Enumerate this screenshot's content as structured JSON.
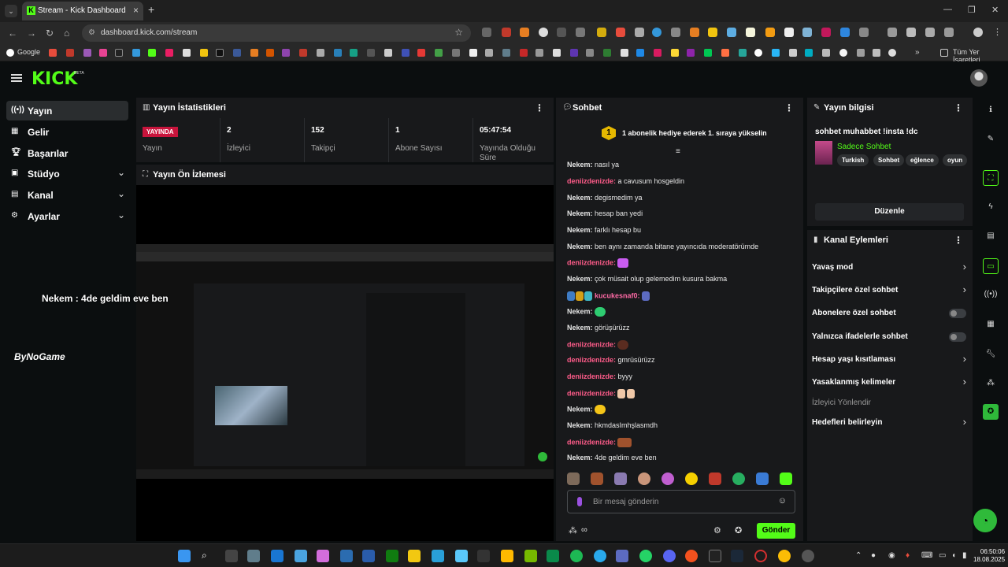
{
  "browser": {
    "tab_title": "Stream - Kick Dashboard",
    "url": "dashboard.kick.com/stream",
    "bookmark_google": "Google",
    "bookmark_all": "Tüm Yer İşaretleri"
  },
  "app": {
    "logo": "KICK",
    "logo_badge": "BETA"
  },
  "sidebar": {
    "items": [
      {
        "label": "Yayın",
        "icon": "broadcast-icon"
      },
      {
        "label": "Gelir",
        "icon": "income-icon"
      },
      {
        "label": "Başarılar",
        "icon": "trophy-icon"
      },
      {
        "label": "Stüdyo",
        "icon": "studio-icon"
      },
      {
        "label": "Kanal",
        "icon": "channel-icon"
      },
      {
        "label": "Ayarlar",
        "icon": "settings-icon"
      }
    ]
  },
  "stats": {
    "title": "Yayın İstatistikleri",
    "live_badge": "YAYINDA",
    "live_label": "Yayın",
    "viewers_value": "2",
    "viewers_label": "İzleyici",
    "followers_value": "152",
    "followers_label": "Takipçi",
    "subs_value": "1",
    "subs_label": "Abone Sayısı",
    "uptime_value": "05:47:54",
    "uptime_label": "Yayında Olduğu Süre"
  },
  "preview": {
    "title": "Yayın Ön İzlemesi",
    "overlay_text": "Nekem : 4de geldim eve ben",
    "overlay_logo": "ByNoGame"
  },
  "chat": {
    "title": "Sohbet",
    "pinned_rank": "1",
    "pinned_text": "1 abonelik hediye ederek 1. sıraya yükselin",
    "messages": [
      {
        "user": "Nekem:",
        "text": " nasıl ya",
        "kind": "nekem"
      },
      {
        "user": "deniizdenizde:",
        "text": " a cavusum hosgeldin",
        "kind": "deniz"
      },
      {
        "user": "Nekem:",
        "text": " degismedim ya",
        "kind": "nekem"
      },
      {
        "user": "Nekem:",
        "text": " hesap ban yedi",
        "kind": "nekem"
      },
      {
        "user": "Nekem:",
        "text": " farklı hesap bu",
        "kind": "nekem"
      },
      {
        "user": "Nekem:",
        "text": " ben aynı zamanda bitane yayıncıda moderatörümde",
        "kind": "nekem"
      },
      {
        "user": "deniizdenizde:",
        "text": "",
        "kind": "deniz"
      },
      {
        "user": "Nekem:",
        "text": " çok müsait olup gelemedim kusura bakma",
        "kind": "nekem"
      },
      {
        "user": "kucukesnaf0:",
        "text": "",
        "kind": "kucuk"
      },
      {
        "user": "Nekem:",
        "text": "",
        "kind": "nekem"
      },
      {
        "user": "Nekem:",
        "text": " görüşürüzz",
        "kind": "nekem"
      },
      {
        "user": "deniizdenizde:",
        "text": "",
        "kind": "deniz"
      },
      {
        "user": "deniizdenizde:",
        "text": " gmrüsürüzz",
        "kind": "deniz"
      },
      {
        "user": "deniizdenizde:",
        "text": " byyy",
        "kind": "deniz"
      },
      {
        "user": "deniizdenizde:",
        "text": "",
        "kind": "deniz"
      },
      {
        "user": "Nekem:",
        "text": "",
        "kind": "nekem"
      },
      {
        "user": "Nekem:",
        "text": " hkmdasImhşlasmdh",
        "kind": "nekem"
      },
      {
        "user": "deniizdenizde:",
        "text": "",
        "kind": "deniz"
      },
      {
        "user": "Nekem:",
        "text": " 4de geldim eve ben",
        "kind": "nekem"
      }
    ],
    "input_placeholder": "Bir mesaj gönderin",
    "send_label": "Gönder"
  },
  "info": {
    "title": "Yayın bilgisi",
    "stream_title": "sohbet muhabbet !insta !dc",
    "category": "Sadece Sohbet",
    "tags": [
      "Turkish",
      "Sohbet",
      "eğlence",
      "oyun"
    ],
    "edit_label": "Düzenle"
  },
  "actions": {
    "title": "Kanal Eylemleri",
    "items": [
      {
        "label": "Yavaş mod",
        "type": "chevron"
      },
      {
        "label": "Takipçilere özel sohbet",
        "type": "chevron"
      },
      {
        "label": "Abonelere özel sohbet",
        "type": "toggle"
      },
      {
        "label": "Yalnızca ifadelerle sohbet",
        "type": "toggle"
      },
      {
        "label": "Hesap yaşı kısıtlaması",
        "type": "chevron"
      },
      {
        "label": "Yasaklanmış kelimeler",
        "type": "chevron"
      },
      {
        "label": "İzleyici Yönlendir",
        "type": "none"
      },
      {
        "label": "Hedefleri belirleyin",
        "type": "chevron"
      }
    ]
  },
  "taskbar": {
    "time": "06:50:06",
    "date": "18.08.2025"
  },
  "colors": {
    "brand": "#53fc18",
    "live": "#c8143c",
    "chat_user_pink": "#ff5c8a"
  }
}
